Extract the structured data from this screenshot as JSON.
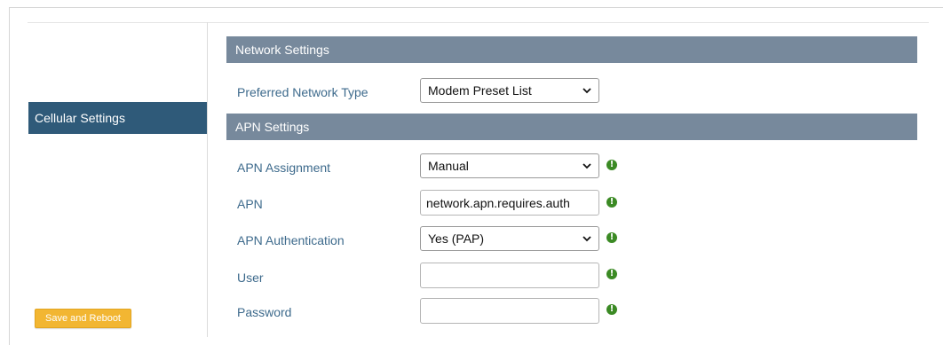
{
  "sidebar": {
    "items": [
      {
        "label": "Cellular Settings",
        "active": true
      }
    ],
    "save_button": "Save and Reboot"
  },
  "network_settings": {
    "header": "Network Settings",
    "preferred_network_type": {
      "label": "Preferred Network Type",
      "value": "Modem Preset List"
    }
  },
  "apn_settings": {
    "header": "APN Settings",
    "apn_assignment": {
      "label": "APN Assignment",
      "value": "Manual"
    },
    "apn": {
      "label": "APN",
      "value": "network.apn.requires.auth"
    },
    "apn_authentication": {
      "label": "APN Authentication",
      "value": "Yes (PAP)"
    },
    "user": {
      "label": "User",
      "value": ""
    },
    "password": {
      "label": "Password",
      "value": ""
    }
  },
  "colors": {
    "nav_active_bg": "#2f5a79",
    "section_header_bg": "#77899c",
    "label_text": "#3d6a8c",
    "save_button_bg": "#f2b632",
    "info_icon": "#3b8a24"
  },
  "icons": {
    "info": "info-icon",
    "dropdown": "chevron-down-icon"
  }
}
